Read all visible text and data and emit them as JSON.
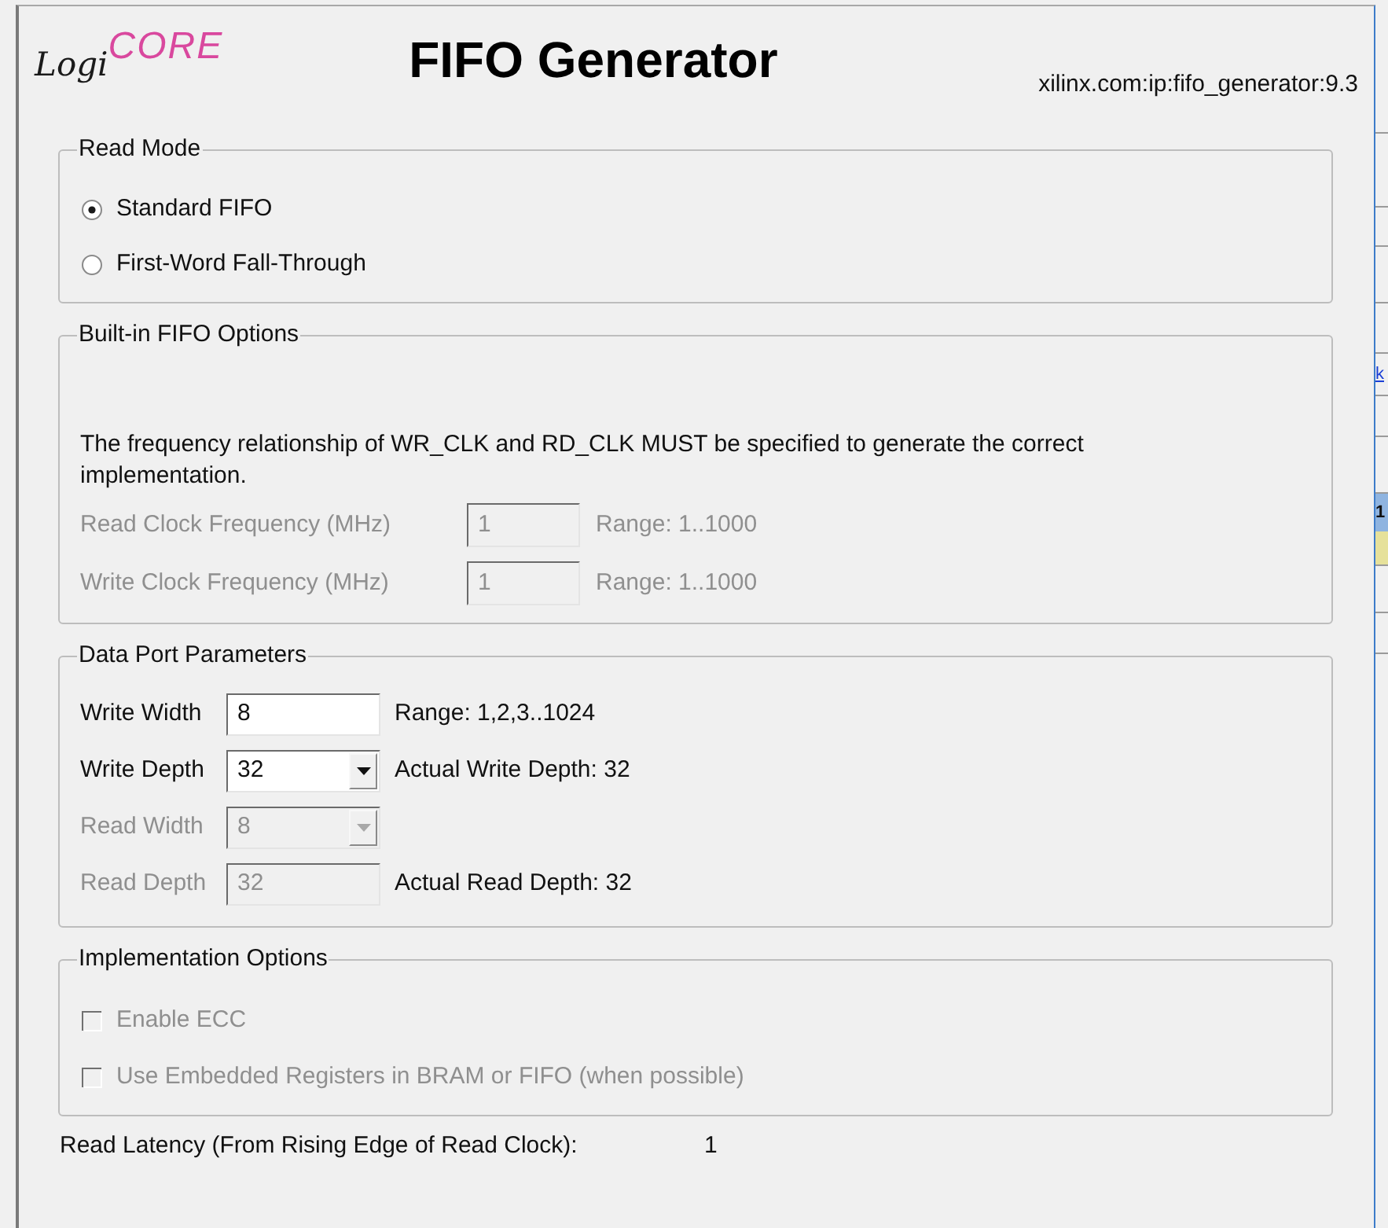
{
  "header": {
    "logo": {
      "script": "Logi",
      "emblem": "CORE"
    },
    "title": "FIFO Generator",
    "core_id": "xilinx.com:ip:fifo_generator:9.3"
  },
  "read_mode": {
    "legend": "Read Mode",
    "options": [
      {
        "label": "Standard FIFO",
        "selected": true
      },
      {
        "label": "First-Word Fall-Through",
        "selected": false
      }
    ]
  },
  "builtin_fifo_options": {
    "legend": "Built-in FIFO Options",
    "note": "The frequency relationship of WR_CLK and RD_CLK MUST be specified to generate the correct implementation.",
    "fields": [
      {
        "label": "Read Clock Frequency (MHz)",
        "value": "1",
        "range": "Range: 1..1000",
        "disabled": true
      },
      {
        "label": "Write Clock Frequency (MHz)",
        "value": "1",
        "range": "Range: 1..1000",
        "disabled": true
      }
    ]
  },
  "data_port_parameters": {
    "legend": "Data Port Parameters",
    "rows": [
      {
        "kind": "input",
        "label": "Write Width",
        "value": "8",
        "note": "Range: 1,2,3..1024",
        "disabled": false
      },
      {
        "kind": "dropdown",
        "label": "Write Depth",
        "value": "32",
        "note": "Actual Write Depth: 32",
        "disabled": false
      },
      {
        "kind": "dropdown",
        "label": "Read Width",
        "value": "8",
        "disabled": true
      },
      {
        "kind": "input",
        "label": "Read Depth",
        "value": "32",
        "note": "Actual Read Depth: 32",
        "disabled": true
      }
    ]
  },
  "implementation_options": {
    "legend": "Implementation Options",
    "options": [
      {
        "label": "Enable ECC",
        "checked": false,
        "disabled": true
      },
      {
        "label": "Use Embedded Registers in BRAM or FIFO (when possible)",
        "checked": false,
        "disabled": true
      }
    ]
  },
  "read_latency": {
    "label": "Read Latency (From Rising Edge of Read Clock):",
    "value": "1"
  },
  "background_window": {
    "link": "k",
    "cell": "1"
  }
}
